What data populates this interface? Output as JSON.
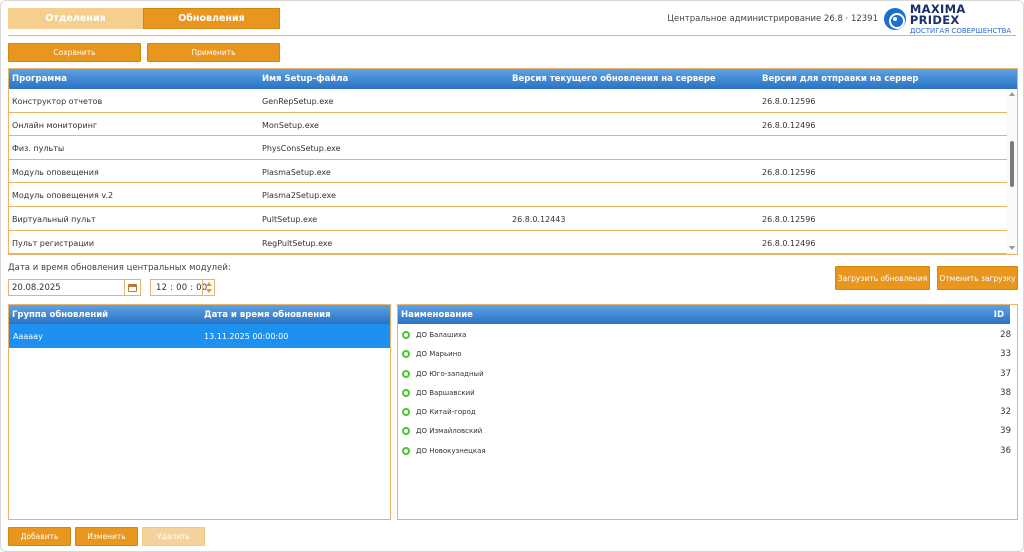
{
  "tabs": [
    {
      "label": "Отделения",
      "active": false
    },
    {
      "label": "Обновления",
      "active": true
    }
  ],
  "header": {
    "info": "Центральное администрирование 26.8 · 12391",
    "logo_title": "MAXIMA PRIDEX",
    "logo_subtitle": "ДОСТИГАЯ СОВЕРШЕНСТВА"
  },
  "toolbar": {
    "save_label": "Сохранить",
    "apply_label": "Применить"
  },
  "updates_table": {
    "columns": [
      "Программа",
      "Имя Setup-файла",
      "Версия текущего обновления на сервере",
      "Версия для отправки на сервер"
    ],
    "rows": [
      {
        "program": "Конструктор отчетов",
        "setup": "GenRepSetup.exe",
        "current": "",
        "send": "26.8.0.12596"
      },
      {
        "program": "Онлайн мониторинг",
        "setup": "MonSetup.exe",
        "current": "",
        "send": "26.8.0.12496"
      },
      {
        "program": "Физ. пульты",
        "setup": "PhysConsSetup.exe",
        "current": "",
        "send": ""
      },
      {
        "program": "Модуль оповещения",
        "setup": "PlasmaSetup.exe",
        "current": "",
        "send": "26.8.0.12596"
      },
      {
        "program": "Модуль оповещения v.2",
        "setup": "Plasma2Setup.exe",
        "current": "",
        "send": ""
      },
      {
        "program": "Виртуальный пульт",
        "setup": "PultSetup.exe",
        "current": "26.8.0.12443",
        "send": "26.8.0.12596"
      },
      {
        "program": "Пульт регистрации",
        "setup": "RegPultSetup.exe",
        "current": "",
        "send": "26.8.0.12496"
      }
    ]
  },
  "schedule": {
    "label": "Дата и время обновления центральных модулей:",
    "date": "20.08.2025",
    "time": "12 : 00 : 00"
  },
  "actions": {
    "load_label": "Загрузить обновления",
    "cancel_label": "Отменить загрузку"
  },
  "groups_panel": {
    "columns": [
      "Группа обновлений",
      "Дата и время обновления"
    ],
    "rows": [
      {
        "name": "Ааааау",
        "datetime": "13.11.2025 00:00:00"
      }
    ]
  },
  "branches_panel": {
    "columns": [
      "Наименование",
      "ID"
    ],
    "rows": [
      {
        "name": "ДО Балашиха",
        "id": "28"
      },
      {
        "name": "ДО Марьино",
        "id": "33"
      },
      {
        "name": "ДО Юго-западный",
        "id": "37"
      },
      {
        "name": "ДО Варшавский",
        "id": "38"
      },
      {
        "name": "ДО Китай-город",
        "id": "32"
      },
      {
        "name": "ДО Измайловский",
        "id": "39"
      },
      {
        "name": "ДО Новокузнецкая",
        "id": "36"
      }
    ]
  },
  "bottom": {
    "add_label": "Добавить",
    "edit_label": "Изменить",
    "delete_label": "Удалить"
  },
  "colors": {
    "accent": "#e8961e",
    "header_blue": "#2a72c3",
    "selection": "#1e90f0",
    "status_ok": "#4ac62f"
  }
}
